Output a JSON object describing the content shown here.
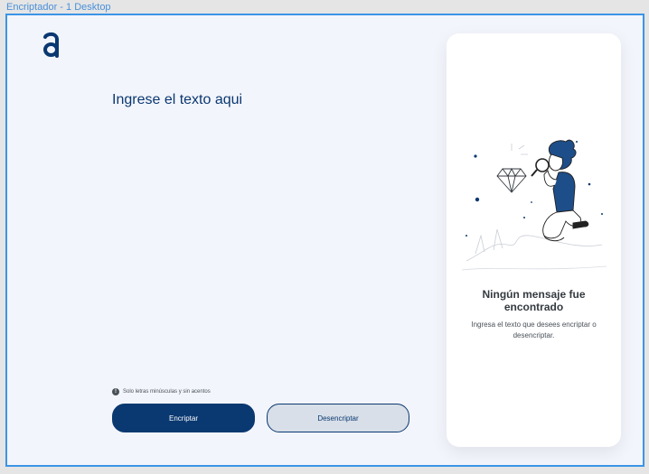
{
  "frame_label": "Encriptador - 1 Desktop",
  "logo": {
    "icon": "alura-a-logo",
    "color": "#0a3871"
  },
  "input": {
    "placeholder": "Ingrese el texto aqui"
  },
  "note": {
    "icon": "info-icon",
    "text": "Solo letras minúsculas y sin acentos"
  },
  "buttons": {
    "encrypt_label": "Encriptar",
    "decrypt_label": "Desencriptar"
  },
  "output": {
    "title": "Ningún mensaje fue encontrado",
    "description": "Ingresa el texto que desees encriptar o desencriptar.",
    "illustration": "person-with-magnifying-glass-and-diamond"
  },
  "colors": {
    "primary": "#0a3871",
    "background": "#f3f5fc",
    "frame_border": "#3b95e6",
    "secondary_button": "#d8dfe8"
  }
}
